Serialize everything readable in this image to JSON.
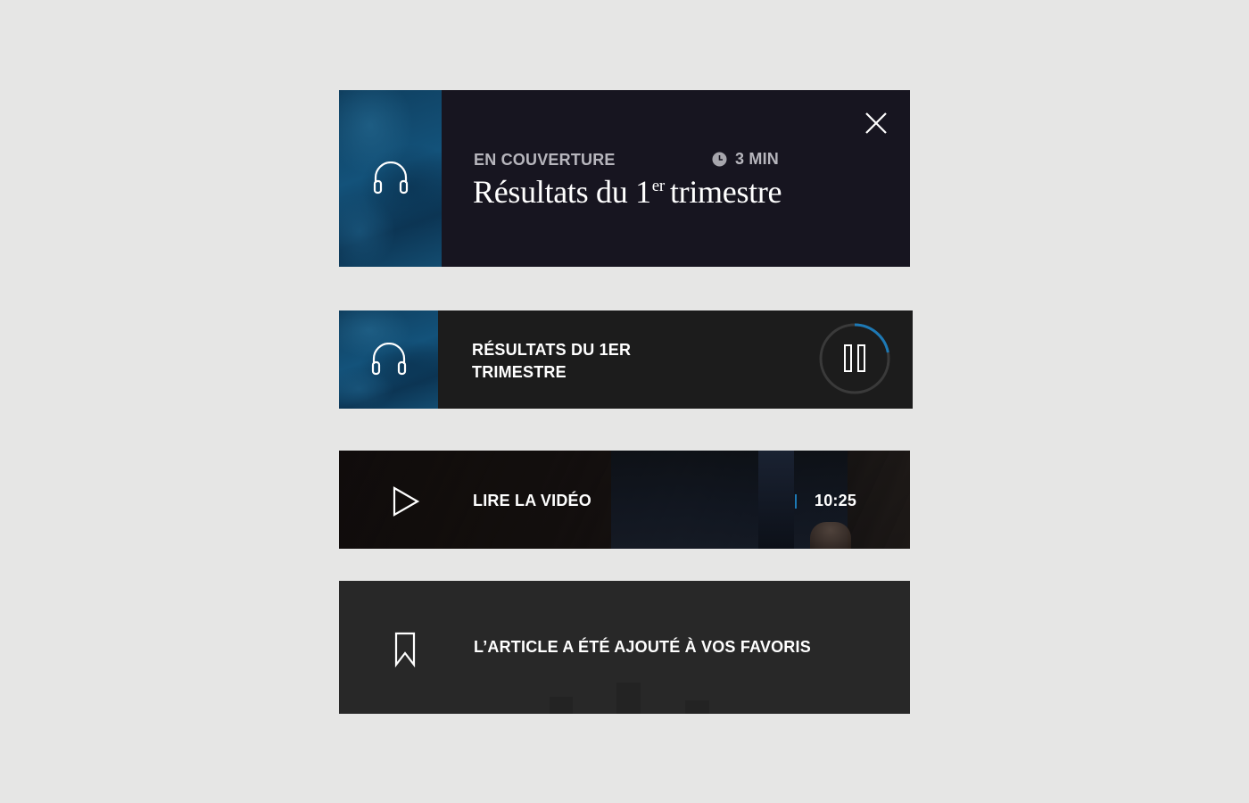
{
  "cover_card": {
    "kicker": "EN COUVERTURE",
    "duration": "3 MIN",
    "title_main": "Résultats du 1",
    "title_sup": "er",
    "title_end": "trimestre",
    "thumb_icon": "headphones-icon",
    "close_icon": "close-icon",
    "clock_icon": "clock-icon"
  },
  "player_card": {
    "title": "RÉSULTATS DU 1ER TRIMESTRE",
    "thumb_icon": "headphones-icon",
    "control_icon": "pause-icon",
    "progress": 0.22,
    "progress_color": "#1d79b5"
  },
  "video_card": {
    "label": "LIRE LA VIDÉO",
    "duration": "10:25",
    "play_icon": "play-icon",
    "accent_color": "#1d79b5"
  },
  "toast_card": {
    "message": "L’ARTICLE A ÉTÉ AJOUTÉ À VOS FAVORIS",
    "icon": "bookmark-icon"
  }
}
